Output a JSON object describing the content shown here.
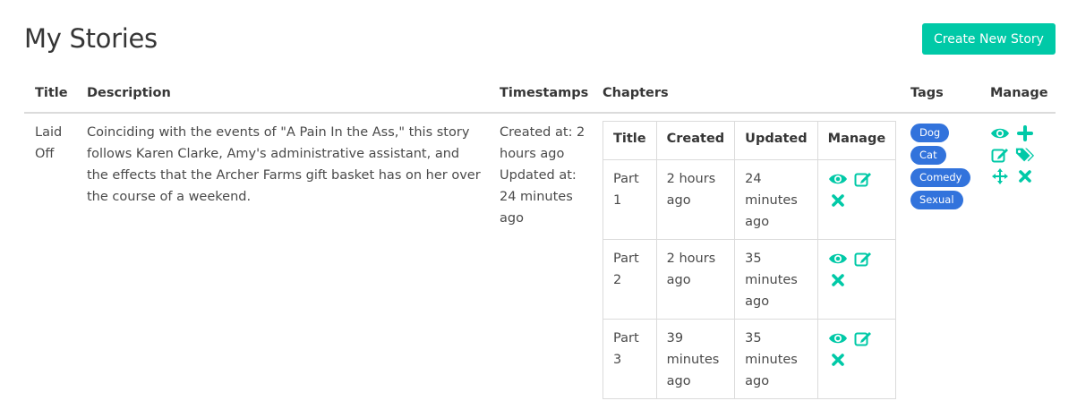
{
  "header": {
    "title": "My Stories",
    "create_button": "Create New Story"
  },
  "table": {
    "columns": [
      "Title",
      "Description",
      "Timestamps",
      "Chapters",
      "Tags",
      "Manage"
    ],
    "rows": [
      {
        "title": "Laid Off",
        "description": "Coinciding with the events of \"A Pain In the Ass,\" this story follows Karen Clarke, Amy's administrative assistant, and the effects that the Archer Farms gift basket has on her over the course of a weekend.",
        "created": "Created at: 2 hours ago",
        "updated": "Updated at: 24 minutes ago",
        "chapters": {
          "columns": [
            "Title",
            "Created",
            "Updated",
            "Manage"
          ],
          "rows": [
            {
              "title": "Part 1",
              "created": "2 hours ago",
              "updated": "24 minutes ago"
            },
            {
              "title": "Part 2",
              "created": "2 hours ago",
              "updated": "35 minutes ago"
            },
            {
              "title": "Part 3",
              "created": "39 minutes ago",
              "updated": "35 minutes ago"
            }
          ],
          "row_icons": [
            "eye-icon",
            "edit-icon",
            "close-icon"
          ]
        },
        "tags": [
          "Dog",
          "Cat",
          "Comedy",
          "Sexual"
        ],
        "manage_icons": [
          "eye-icon",
          "plus-icon",
          "edit-icon",
          "tags-icon",
          "move-icon",
          "close-icon"
        ]
      }
    ]
  },
  "colors": {
    "accent": "#00c9a7",
    "tag": "#3273dc",
    "border": "#dbdbdb"
  }
}
